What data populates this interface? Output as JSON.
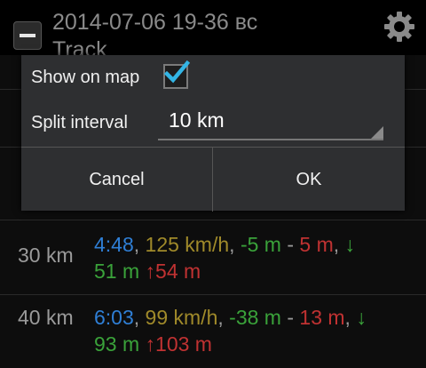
{
  "header": {
    "title": "2014-07-06 19-36 вс",
    "subtitle": "Track"
  },
  "rows": [
    {
      "distance": "30 km",
      "time": "4:48",
      "speed": "125 km/h",
      "elev_a": "-5 m",
      "elev_b": "5 m",
      "down_arrow": "↓",
      "down": "51 m",
      "up_arrow": "↑",
      "up": "54 m"
    },
    {
      "distance": "40 km",
      "time": "6:03",
      "speed": "99 km/h",
      "elev_a": "-38 m",
      "elev_b": "13 m",
      "down_arrow": "↓",
      "down": "93 m",
      "up_arrow": "↑",
      "up": "103 m"
    }
  ],
  "separators": {
    "comma": ",",
    "dash": "-"
  },
  "dialog": {
    "show_on_map_label": "Show on map",
    "show_on_map_checked": true,
    "split_interval_label": "Split interval",
    "split_interval_value": "10 km",
    "cancel_label": "Cancel",
    "ok_label": "OK"
  },
  "icons": {
    "collapse": "minus-square-icon",
    "settings": "gear-icon",
    "checkbox": "checkmark-icon"
  },
  "colors": {
    "time": "#2f7fd6",
    "speed": "#a08a2a",
    "elevation_low": "#3aa23a",
    "elevation_high": "#c03232",
    "checkmark": "#33b5e5"
  }
}
